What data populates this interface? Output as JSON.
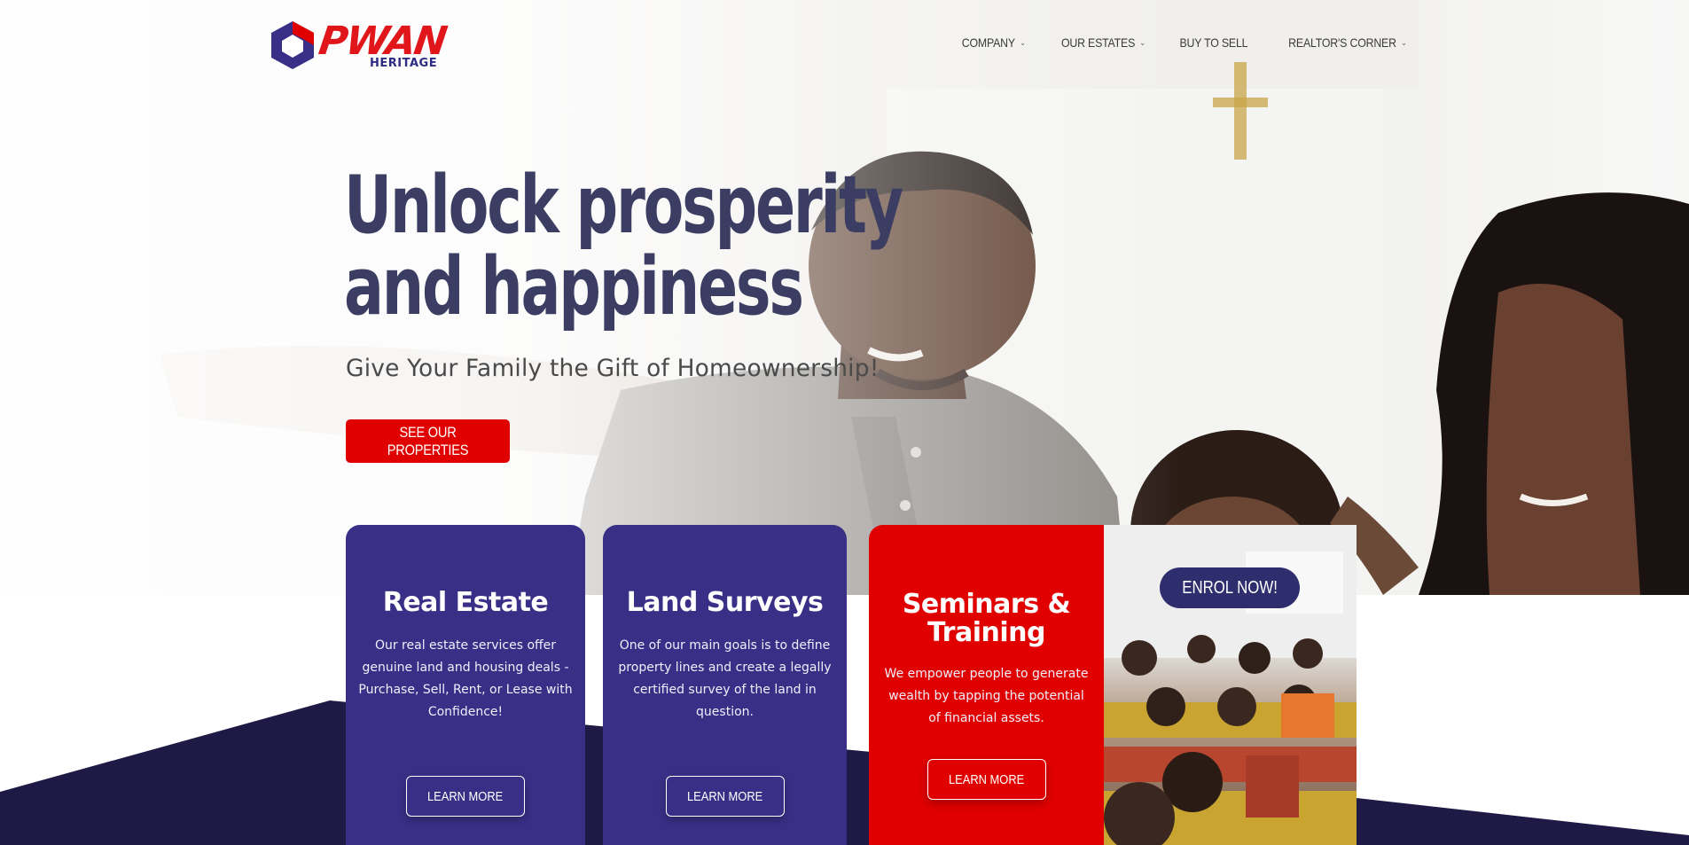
{
  "brand": {
    "name": "PWAN",
    "subname": "HERITAGE",
    "colors": {
      "primary_red": "#e00000",
      "primary_purple": "#3a2f86",
      "navy": "#1e1a45",
      "title_ink": "#3b3e62"
    }
  },
  "nav": {
    "items": [
      {
        "label": "COMPANY",
        "has_dropdown": true
      },
      {
        "label": "OUR ESTATES",
        "has_dropdown": true
      },
      {
        "label": "BUY TO SELL",
        "has_dropdown": false
      },
      {
        "label": "REALTOR'S CORNER",
        "has_dropdown": true
      }
    ],
    "dropdown_icon": "chevron-down-icon"
  },
  "hero": {
    "title_line1": "Unlock prosperity",
    "title_line2": "and happiness",
    "subtitle": "Give Your Family the Gift of Homeownership!",
    "cta_label": "SEE OUR PROPERTIES"
  },
  "cards": [
    {
      "title": "Real Estate",
      "lines": [
        "Our real estate services offer",
        "genuine land and housing deals -",
        "Purchase, Sell, Rent, or Lease with",
        "Confidence!"
      ],
      "button": "LEARN MORE"
    },
    {
      "title": "Land Surveys",
      "lines": [
        "One of our main goals is to define",
        "property lines and create a legally",
        "certified survey of the land in",
        "question."
      ],
      "button": "LEARN MORE"
    },
    {
      "title_line1": "Seminars &",
      "title_line2": "Training",
      "lines": [
        "We empower people to generate",
        "wealth by tapping the potential",
        "of financial assets."
      ],
      "button": "LEARN MORE"
    }
  ],
  "seminar_photo": {
    "button": "ENROL NOW!"
  }
}
